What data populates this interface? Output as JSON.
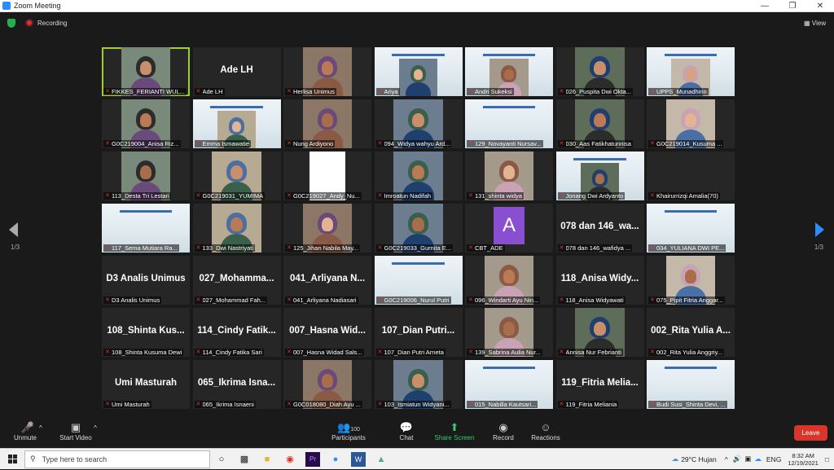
{
  "window": {
    "title": "Zoom Meeting",
    "controls": [
      "—",
      "❐",
      "✕"
    ]
  },
  "topbar": {
    "recording": "Recording",
    "view": "View"
  },
  "pagination": {
    "left": "1/3",
    "right": "1/3"
  },
  "participants": [
    {
      "label": "FIKKES_FERIANTI WUL...",
      "big": "",
      "type": "cam"
    },
    {
      "label": "Ade LH",
      "big": "Ade LH",
      "type": "name"
    },
    {
      "label": "Herlisa Unimus",
      "big": "",
      "type": "cam"
    },
    {
      "label": "Ariya",
      "big": "",
      "type": "slidecam"
    },
    {
      "label": "Andri Sukeksi",
      "big": "",
      "type": "slidecam"
    },
    {
      "label": "026_Puspita Dwi Okta...",
      "big": "",
      "type": "cam"
    },
    {
      "label": "UPPS_Munadhirin",
      "big": "",
      "type": "slidecam"
    },
    {
      "label": "G0C219004_Anisa Riz...",
      "big": "",
      "type": "cam"
    },
    {
      "label": "Emma Ismawatie",
      "big": "",
      "type": "slidecam"
    },
    {
      "label": "Nung Ardiyono",
      "big": "",
      "type": "cam"
    },
    {
      "label": "094_Widya wahyu Ard...",
      "big": "",
      "type": "cam"
    },
    {
      "label": "129_Novayanti Nursav...",
      "big": "",
      "type": "slide"
    },
    {
      "label": "030_Aas Fatikhatunnisa",
      "big": "",
      "type": "cam"
    },
    {
      "label": "G0C219014_Kusuma ...",
      "big": "",
      "type": "cam"
    },
    {
      "label": "113_Desta Tri Lestari",
      "big": "",
      "type": "cam"
    },
    {
      "label": "G0C219031_YUMIMA",
      "big": "",
      "type": "cam"
    },
    {
      "label": "G0C219027_Andy_Nu...",
      "big": "",
      "type": "white"
    },
    {
      "label": "Imroatun Nadifah",
      "big": "",
      "type": "cam"
    },
    {
      "label": "131_shinta widya",
      "big": "",
      "type": "cam"
    },
    {
      "label": "Jonang Dwi Ardyanto",
      "big": "",
      "type": "slidecam"
    },
    {
      "label": "Khairurrizqi Amalia(70)",
      "big": "",
      "type": "name"
    },
    {
      "label": "117_Sema Mutiara Ra...",
      "big": "",
      "type": "slide"
    },
    {
      "label": "133_Dwi Nastriyati",
      "big": "",
      "type": "cam"
    },
    {
      "label": "125_Jihan Nabila May...",
      "big": "",
      "type": "cam"
    },
    {
      "label": "G0C219033_Gurnita E...",
      "big": "",
      "type": "cam"
    },
    {
      "label": "CBT_ADE",
      "big": "",
      "type": "avatar",
      "avatar": "A"
    },
    {
      "label": "078 dan 146_wafidya ...",
      "big": "078 dan 146_wa...",
      "type": "name"
    },
    {
      "label": "034_YULIANA DWI PE...",
      "big": "",
      "type": "slide"
    },
    {
      "label": "D3 Analis Unimus",
      "big": "D3 Analis Unimus",
      "type": "name"
    },
    {
      "label": "027_Mohammad Fah...",
      "big": "027_Mohamma...",
      "type": "name"
    },
    {
      "label": "041_Arliyana Nadiasari",
      "big": "041_Arliyana N...",
      "type": "name"
    },
    {
      "label": "G0C219006_Nurul Putri",
      "big": "",
      "type": "slide"
    },
    {
      "label": "096_Windarti Ayu Nin...",
      "big": "",
      "type": "cam"
    },
    {
      "label": "118_Anisa Widyawati",
      "big": "118_Anisa Widy...",
      "type": "name"
    },
    {
      "label": "075_Pipit Fitria Anggar...",
      "big": "",
      "type": "cam"
    },
    {
      "label": "108_Shinta Kusuma Dewi",
      "big": "108_Shinta Kus...",
      "type": "name"
    },
    {
      "label": "114_Cindy Fatika Sari",
      "big": "114_Cindy Fatik...",
      "type": "name"
    },
    {
      "label": "007_Hasna Widad Sals...",
      "big": "007_Hasna Wid...",
      "type": "name"
    },
    {
      "label": "107_Dian Putri Arneta",
      "big": "107_Dian Putri...",
      "type": "name"
    },
    {
      "label": "139_Sabrina Aulia Nur...",
      "big": "",
      "type": "cam"
    },
    {
      "label": "Annisa Nur Febrianti",
      "big": "",
      "type": "cam"
    },
    {
      "label": "002_Rita Yulia Anggriy...",
      "big": "002_Rita Yulia A...",
      "type": "name"
    },
    {
      "label": "Umi Masturah",
      "big": "Umi Masturah",
      "type": "name"
    },
    {
      "label": "065_Ikrima Isnaeni",
      "big": "065_Ikrima Isna...",
      "type": "name"
    },
    {
      "label": "G0C018080_Diah Ayu ...",
      "big": "",
      "type": "cam"
    },
    {
      "label": "103_Ismiatun Widyani...",
      "big": "",
      "type": "cam"
    },
    {
      "label": "015_Nabilla Kautsari...",
      "big": "",
      "type": "slide"
    },
    {
      "label": "119_Fitria Meliania",
      "big": "119_Fitria Melia...",
      "type": "name"
    },
    {
      "label": "Budi Susi_Shinta Devi, ...",
      "big": "",
      "type": "slide"
    }
  ],
  "toolbar": {
    "unmute": "Unmute",
    "start_video": "Start Video",
    "participants": "Participants",
    "participants_count": "100",
    "chat": "Chat",
    "share_screen": "Share Screen",
    "record": "Record",
    "reactions": "Reactions",
    "leave": "Leave"
  },
  "taskbar": {
    "search_placeholder": "Type here to search",
    "weather": "29°C  Hujan",
    "language": "ENG",
    "time": "8:32 AM",
    "date": "12/19/2021"
  },
  "colors": {
    "accent": "#2d8cff",
    "leave": "#d9352a",
    "active_border": "#9bd12a",
    "share": "#2ecc71"
  }
}
